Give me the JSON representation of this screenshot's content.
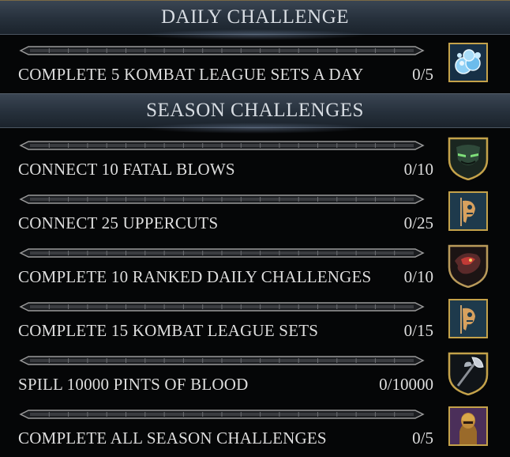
{
  "daily": {
    "title": "DAILY CHALLENGE",
    "items": [
      {
        "label": "COMPLETE 5 KOMBAT LEAGUE SETS A DAY",
        "progress": "0/5",
        "progress_fraction": 0,
        "reward_icon": "soul-orbs-icon"
      }
    ]
  },
  "season": {
    "title": "SEASON CHALLENGES",
    "items": [
      {
        "label": "CONNECT 10 FATAL BLOWS",
        "progress": "0/10",
        "progress_fraction": 0,
        "reward_icon": "mask-icon"
      },
      {
        "label": "CONNECT 25 UPPERCUTS",
        "progress": "0/25",
        "progress_fraction": 0,
        "reward_icon": "skull-banner-icon"
      },
      {
        "label": "COMPLETE 10 RANKED DAILY CHALLENGES",
        "progress": "0/10",
        "progress_fraction": 0,
        "reward_icon": "dragon-emblem-icon"
      },
      {
        "label": "COMPLETE 15 KOMBAT LEAGUE SETS",
        "progress": "0/15",
        "progress_fraction": 0,
        "reward_icon": "skull-banner-icon"
      },
      {
        "label": "SPILL 10000 PINTS OF BLOOD",
        "progress": "0/10000",
        "progress_fraction": 0,
        "reward_icon": "axe-weapon-icon"
      },
      {
        "label": "COMPLETE ALL SEASON CHALLENGES",
        "progress": "0/5",
        "progress_fraction": 0,
        "reward_icon": "warrior-portrait-icon"
      }
    ]
  },
  "colors": {
    "header_bg": "#2b3540",
    "gold_border": "#c4a24a",
    "text": "#dedede",
    "bar_track": "#9a9a9a"
  }
}
